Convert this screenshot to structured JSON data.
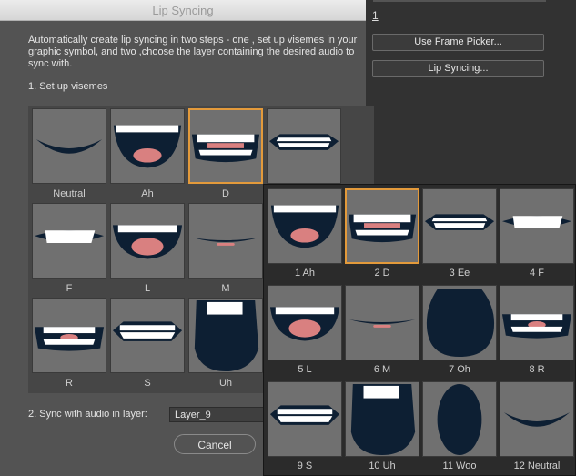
{
  "side_panel": {
    "frame_value": "1",
    "use_frame_picker": "Use Frame Picker...",
    "lip_syncing": "Lip Syncing..."
  },
  "dialog": {
    "title": "Lip Syncing",
    "description": "Automatically create lip syncing in two steps - one , set up visemes in your graphic symbol, and two ,choose the layer containing the desired audio to sync with.",
    "step1": "1. Set up visemes",
    "step2": "2. Sync with audio in layer:",
    "layer_value": "Layer_9",
    "cancel": "Cancel"
  },
  "visemes": [
    {
      "label": "Neutral",
      "shape": "neutral"
    },
    {
      "label": "Ah",
      "shape": "ah"
    },
    {
      "label": "D",
      "shape": "d",
      "selected": true
    },
    {
      "label": "",
      "shape": "ee"
    },
    {
      "label": "F",
      "shape": "f"
    },
    {
      "label": "L",
      "shape": "l"
    },
    {
      "label": "M",
      "shape": "m"
    },
    {
      "label": "",
      "shape": "blank"
    },
    {
      "label": "R",
      "shape": "r"
    },
    {
      "label": "S",
      "shape": "s"
    },
    {
      "label": "Uh",
      "shape": "uh"
    },
    {
      "label": "",
      "shape": "blank"
    }
  ],
  "frame_picker": [
    {
      "label": "1 Ah",
      "shape": "ah"
    },
    {
      "label": "2 D",
      "shape": "d",
      "selected": true
    },
    {
      "label": "3 Ee",
      "shape": "ee"
    },
    {
      "label": "4 F",
      "shape": "f"
    },
    {
      "label": "5 L",
      "shape": "l"
    },
    {
      "label": "6 M",
      "shape": "m"
    },
    {
      "label": "7 Oh",
      "shape": "oh"
    },
    {
      "label": "8 R",
      "shape": "r"
    },
    {
      "label": "9 S",
      "shape": "s"
    },
    {
      "label": "10 Uh",
      "shape": "uh"
    },
    {
      "label": "11 Woo",
      "shape": "woo"
    },
    {
      "label": "12 Neutral",
      "shape": "neutral"
    }
  ],
  "colors": {
    "selection": "#e39a3b",
    "mouth": "#0d1f33",
    "tongue": "#d98080",
    "teeth": "#ffffff",
    "cell": "#707070"
  }
}
